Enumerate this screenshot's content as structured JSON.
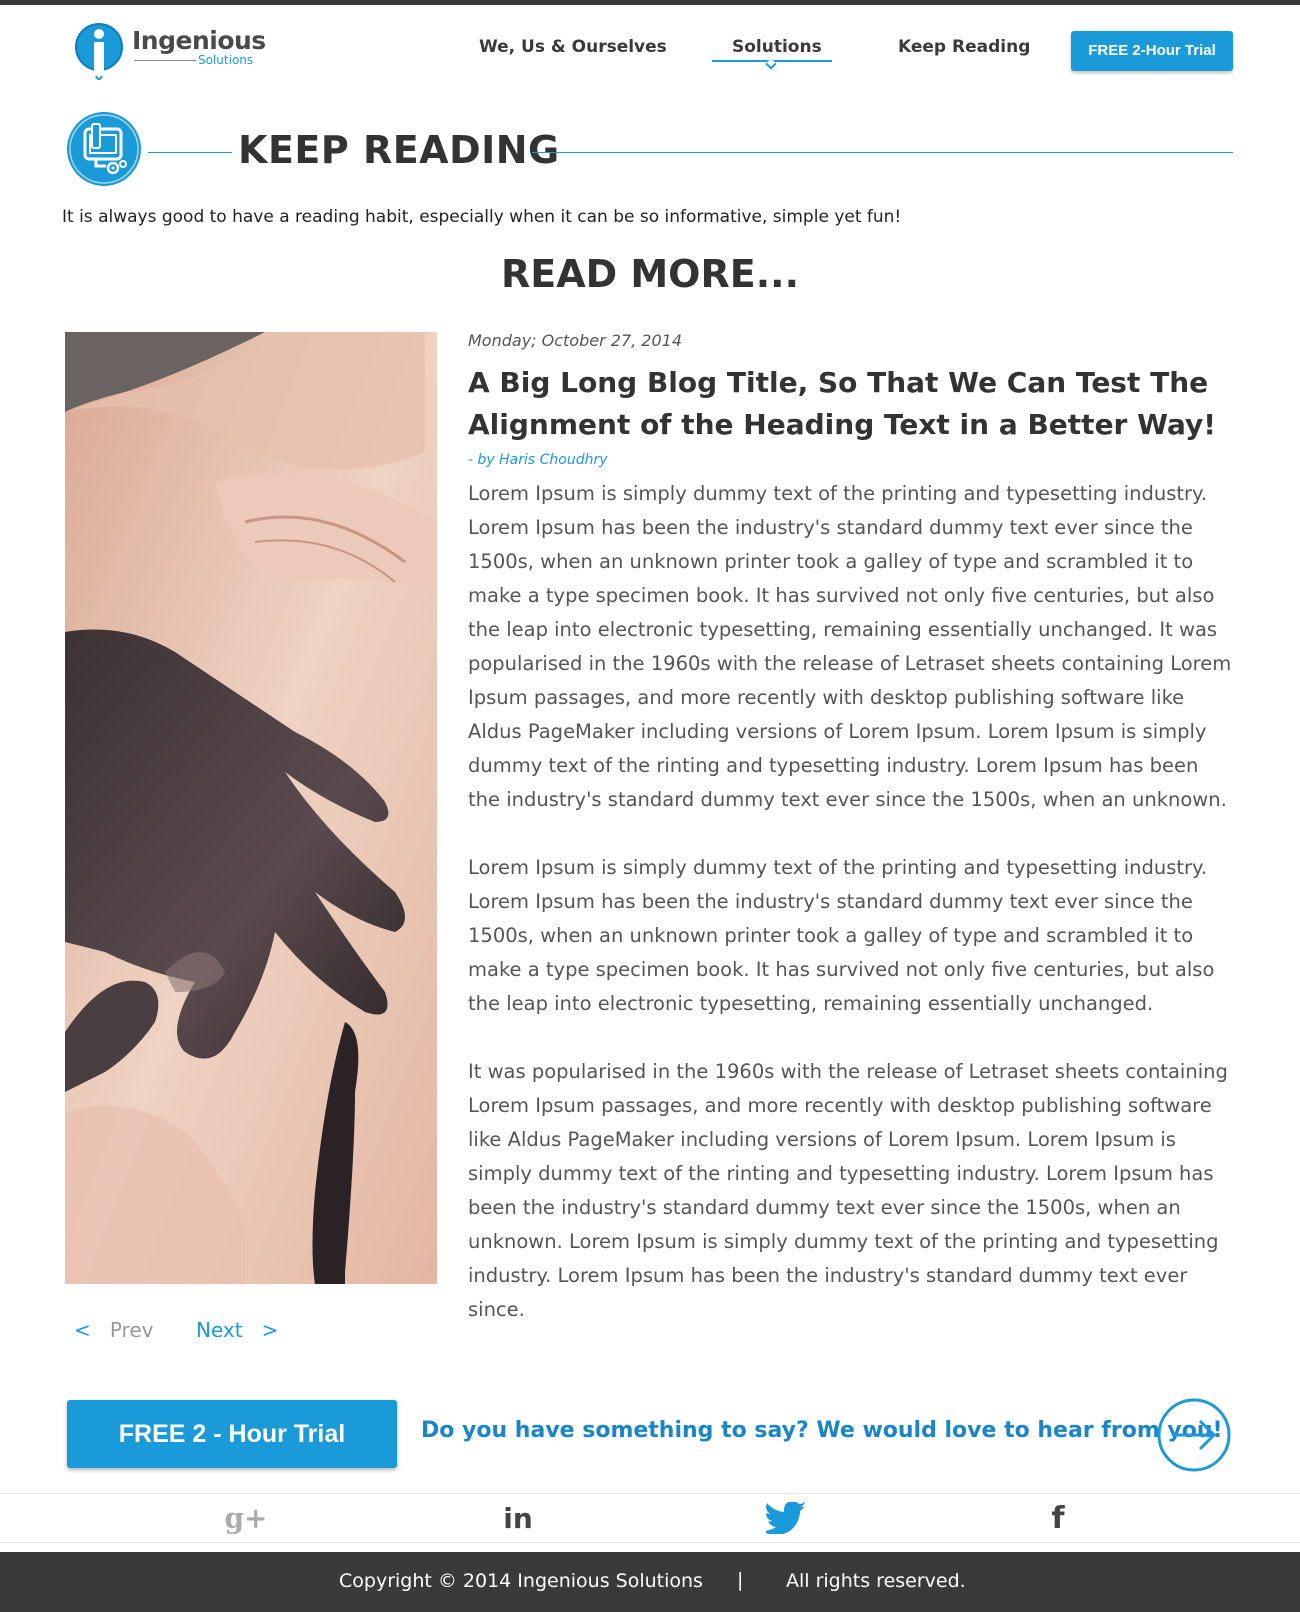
{
  "header": {
    "logo": {
      "name": "Ingenious",
      "sub": "Solutions"
    },
    "nav": [
      {
        "label": "We, Us & Ourselves"
      },
      {
        "label": "Solutions"
      },
      {
        "label": "Keep Reading"
      }
    ],
    "active_nav": "Solutions",
    "trial_button": "FREE 2-Hour Trial"
  },
  "section": {
    "title": "KEEP READING",
    "intro": "It is always good to have a reading habit, especially when it can be so informative, simple yet fun!",
    "subtitle": "READ MORE..."
  },
  "article": {
    "date": "Monday; October 27, 2014",
    "title": "A Big Long Blog Title, So That We Can Test The Alignment of the Heading Text in a Better Way!",
    "author": "- by Haris Choudhry",
    "paragraphs": [
      "Lorem Ipsum is simply dummy text of the printing and typesetting industry. Lorem Ipsum has been the industry's standard dummy text ever since the 1500s, when an unknown printer took a galley of type and scrambled it to make a type specimen book. It has survived not only five centuries, but also the leap into electronic typesetting, remaining essentially unchanged. It was popularised in the 1960s with the release of Letraset sheets containing Lorem Ipsum passages, and more recently with desktop publishing software like Aldus PageMaker including versions of Lorem Ipsum. Lorem Ipsum is simply dummy text of the rinting and typesetting industry. Lorem Ipsum has been the industry's standard dummy text ever since the 1500s, when an unknown.",
      "Lorem Ipsum is simply dummy text of the printing and typesetting industry. Lorem Ipsum has been the industry's standard dummy text ever since the 1500s, when an unknown printer took a galley of type and scrambled it to make a type specimen book. It has survived not only five centuries, but also the leap into electronic typesetting, remaining essentially unchanged.",
      "It was popularised in the 1960s with the release of Letraset sheets containing Lorem Ipsum passages, and more recently with desktop publishing software like Aldus PageMaker including versions of Lorem Ipsum. Lorem Ipsum is simply dummy text of the rinting and typesetting industry. Lorem Ipsum has been the industry's standard dummy text ever since the 1500s, when an unknown. Lorem Ipsum is simply dummy text of the printing and typesetting industry. Lorem Ipsum has been the industry's standard dummy text ever since."
    ]
  },
  "pager": {
    "prev_arrow": "<",
    "prev": "Prev",
    "next": "Next",
    "next_arrow": ">"
  },
  "cta": {
    "button": "FREE 2 - Hour Trial",
    "text": "Do you have something to say? We would love to hear from you!",
    "icon": "arrow-right-circle-icon"
  },
  "social": [
    {
      "icon": "google-plus-icon",
      "glyph": "g+"
    },
    {
      "icon": "linkedin-icon",
      "glyph": "in"
    },
    {
      "icon": "twitter-icon"
    },
    {
      "icon": "facebook-icon",
      "glyph": "f"
    }
  ],
  "footer": {
    "copyright": "Copyright © 2014 Ingenious Solutions",
    "separator": "|",
    "rights": "All rights reserved."
  },
  "colors": {
    "accent": "#1a9ad9",
    "dark_bar": "#3a3a3a",
    "link": "#1a86c8"
  }
}
